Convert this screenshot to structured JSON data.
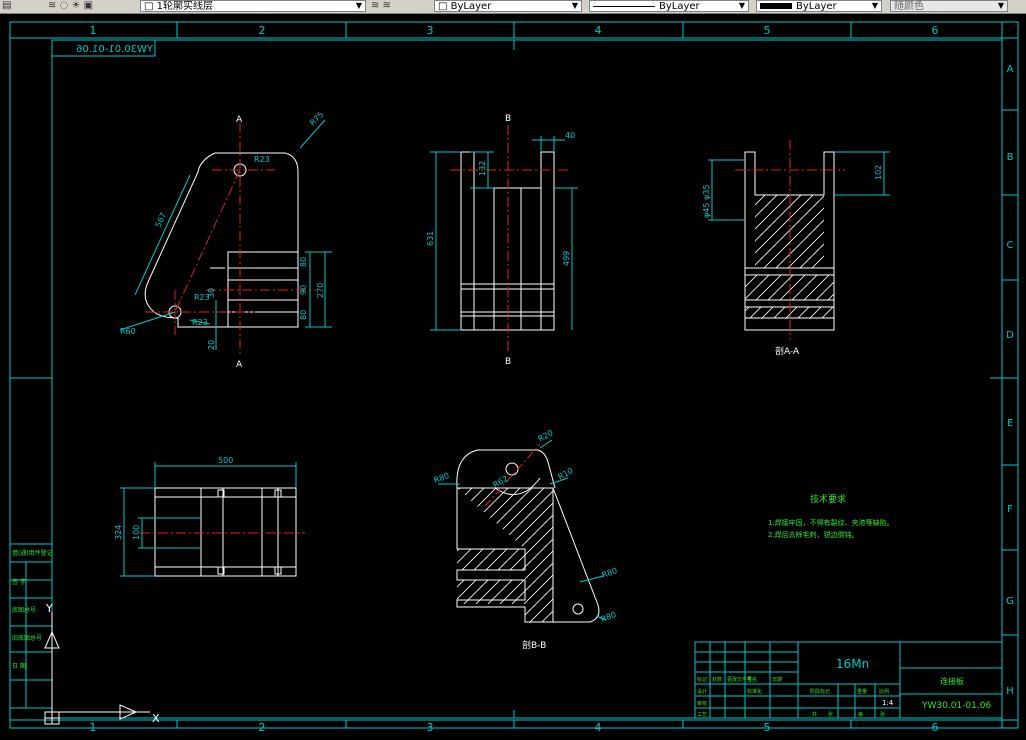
{
  "toolbar": {
    "layer_name": "1轮廓实线层",
    "color_value": "ByLayer",
    "linetype_value": "ByLayer",
    "lineweight_value": "ByLayer",
    "plotstyle_value": "随颜色"
  },
  "frame": {
    "column_numbers": [
      "1",
      "2",
      "3",
      "4",
      "5",
      "6"
    ],
    "row_letters": [
      "A",
      "B",
      "C",
      "D",
      "E",
      "F",
      "G",
      "H"
    ],
    "drawing_number_mirrored": "YW30.01-01.06"
  },
  "views": {
    "front": {
      "section_top": "A",
      "section_bottom": "A",
      "dims": [
        "R75",
        "R23",
        "567",
        "R60",
        "R23",
        "R23",
        "30",
        "80",
        "90",
        "80",
        "270",
        "20"
      ]
    },
    "side": {
      "section_top": "B",
      "section_bottom": "B",
      "dims": [
        "40",
        "132",
        "631",
        "499"
      ]
    },
    "section_aa": {
      "label": "剖A-A",
      "dims": [
        "102",
        "φ45 φ35"
      ]
    },
    "top": {
      "dims": [
        "500",
        "324",
        "100"
      ]
    },
    "section_bb": {
      "label": "剖B-B",
      "dims": [
        "R20",
        "R80",
        "R62",
        "R10",
        "R80",
        "R80"
      ]
    }
  },
  "notes": {
    "heading": "技术要求",
    "lines": [
      "1.焊接牢固，不得有裂纹、夹渣等缺陷。",
      "2.焊后去除毛刺，锐边倒钝。"
    ]
  },
  "left_strip": {
    "labels": [
      "借(通)用件登记",
      "旧底图总号",
      "底图总号",
      "签 字",
      "日 期"
    ]
  },
  "title_block": {
    "material": "16Mn",
    "part_name": "连接板",
    "drawing_number": "YW30.01-01.06",
    "scale": "1:4",
    "cells": [
      "标记",
      "处数",
      "更改文件号",
      "签名",
      "日期",
      "设计",
      "标准化",
      "审核",
      "工艺",
      "阶段标记",
      "重量",
      "比例",
      "共",
      "张",
      "第",
      "张"
    ]
  },
  "ucs": {
    "y": "Y",
    "x": "X"
  }
}
